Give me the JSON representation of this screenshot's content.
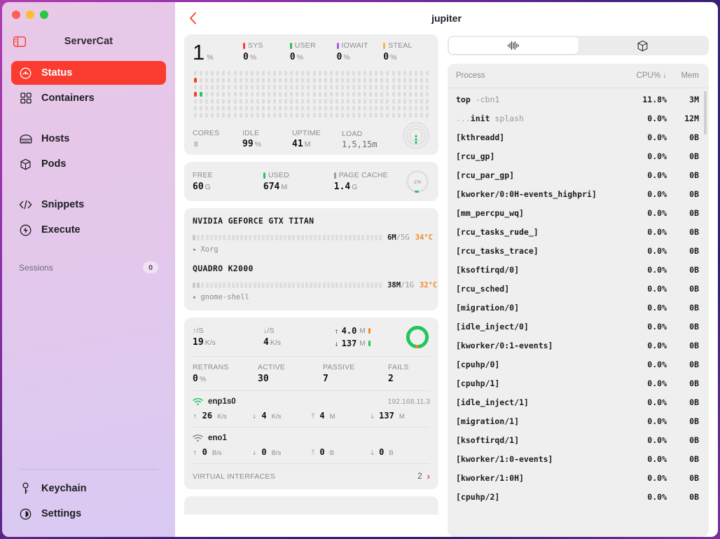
{
  "window": {
    "traffic_lights": [
      "close",
      "minimize",
      "zoom"
    ]
  },
  "sidebar": {
    "app_title": "ServerCat",
    "toggle_icon": "sidebar-toggle-icon",
    "items": [
      {
        "label": "Status",
        "icon": "status-gauge-icon",
        "active": true
      },
      {
        "label": "Containers",
        "icon": "grid-squares-icon",
        "active": false
      },
      {
        "label": "Hosts",
        "icon": "server-rack-icon",
        "active": false
      },
      {
        "label": "Pods",
        "icon": "cube-icon",
        "active": false
      },
      {
        "label": "Snippets",
        "icon": "code-brackets-icon",
        "active": false
      },
      {
        "label": "Execute",
        "icon": "bolt-circle-icon",
        "active": false
      }
    ],
    "sessions_label": "Sessions",
    "sessions_count": "0",
    "bottom_items": [
      {
        "label": "Keychain",
        "icon": "key-icon"
      },
      {
        "label": "Settings",
        "icon": "gear-icon"
      }
    ],
    "accent": "#fa3b30"
  },
  "topbar": {
    "back_icon": "chevron-left-icon",
    "host": "jupiter"
  },
  "cpu": {
    "value": "1",
    "unit": "%",
    "stats": [
      {
        "label": "SYS",
        "value": "0",
        "unit": "%",
        "color": "#fa3b30"
      },
      {
        "label": "USER",
        "value": "0",
        "unit": "%",
        "color": "#22c55e"
      },
      {
        "label": "IOWAIT",
        "value": "0",
        "unit": "%",
        "color": "#a855f7"
      },
      {
        "label": "STEAL",
        "value": "0",
        "unit": "%",
        "color": "#f5b battery"
      }
    ],
    "footer": [
      {
        "label": "CORES",
        "value": "8",
        "unit": ""
      },
      {
        "label": "IDLE",
        "value": "99",
        "unit": "%"
      },
      {
        "label": "UPTIME",
        "value": "41",
        "unit": "M"
      },
      {
        "label": "LOAD",
        "value": "1,5,15m",
        "unit": ""
      }
    ],
    "gauge_icon": "load-rings-gauge"
  },
  "memory": {
    "stats": [
      {
        "label": "FREE",
        "value": "60",
        "unit": "G",
        "color": null
      },
      {
        "label": "USED",
        "value": "674",
        "unit": "M",
        "color": "#22c55e"
      },
      {
        "label": "PAGE CACHE",
        "value": "1.4",
        "unit": "G",
        "color": "#9a9a9a"
      }
    ],
    "gauge_label": "1%"
  },
  "gpus": [
    {
      "name": "NVIDIA GEFORCE GTX TITAN",
      "mem_used": "6M",
      "mem_total": "5G",
      "temp": "34°C",
      "process": "Xorg",
      "bar_pct": 2
    },
    {
      "name": "QUADRO K2000",
      "mem_used": "38M",
      "mem_total": "1G",
      "temp": "32°C",
      "process": "gnome-shell",
      "bar_pct": 4
    }
  ],
  "network": {
    "up_label": "↑/S",
    "up_value": "19",
    "up_unit": "K/s",
    "down_label": "↓/S",
    "down_value": "4",
    "down_unit": "K/s",
    "total_up": "4.0",
    "total_up_unit": "M",
    "total_down": "137",
    "total_down_unit": "M",
    "mid": [
      {
        "label": "RETRANS",
        "value": "0",
        "unit": "%"
      },
      {
        "label": "ACTIVE",
        "value": "30",
        "unit": ""
      },
      {
        "label": "PASSIVE",
        "value": "7",
        "unit": ""
      },
      {
        "label": "FAILS",
        "value": "2",
        "unit": ""
      }
    ],
    "interfaces": [
      {
        "name": "enp1s0",
        "ip": "192.168.11.3",
        "icon": "wifi-icon",
        "online": true,
        "up_rate": "26",
        "up_rate_unit": "K/s",
        "down_rate": "4",
        "down_rate_unit": "K/s",
        "up_total": "4",
        "up_total_unit": "M",
        "down_total": "137",
        "down_total_unit": "M"
      },
      {
        "name": "eno1",
        "ip": "",
        "icon": "wifi-icon",
        "online": false,
        "up_rate": "0",
        "up_rate_unit": "B/s",
        "down_rate": "0",
        "down_rate_unit": "B/s",
        "up_total": "0",
        "up_total_unit": "B",
        "down_total": "0",
        "down_total_unit": "B"
      }
    ],
    "virtual_label": "VIRTUAL INTERFACES",
    "virtual_count": "2"
  },
  "tabs": [
    {
      "icon": "waveform-icon",
      "selected": true
    },
    {
      "icon": "cube-icon",
      "selected": false
    }
  ],
  "processes": {
    "columns": {
      "name": "Process",
      "cpu": "CPU% ↓",
      "mem": "Mem"
    },
    "rows": [
      {
        "name": "top",
        "arg": " -cbn1",
        "dim": "",
        "cpu": "11.8%",
        "mem": "3M"
      },
      {
        "name": "init",
        "arg": " splash",
        "dim": "...",
        "cpu": "0.0%",
        "mem": "12M"
      },
      {
        "name": "[kthreadd]",
        "arg": "",
        "dim": "",
        "cpu": "0.0%",
        "mem": "0B"
      },
      {
        "name": "[rcu_gp]",
        "arg": "",
        "dim": "",
        "cpu": "0.0%",
        "mem": "0B"
      },
      {
        "name": "[rcu_par_gp]",
        "arg": "",
        "dim": "",
        "cpu": "0.0%",
        "mem": "0B"
      },
      {
        "name": "[kworker/0:0H-events_highpri]",
        "arg": "",
        "dim": "",
        "cpu": "0.0%",
        "mem": "0B"
      },
      {
        "name": "[mm_percpu_wq]",
        "arg": "",
        "dim": "",
        "cpu": "0.0%",
        "mem": "0B"
      },
      {
        "name": "[rcu_tasks_rude_]",
        "arg": "",
        "dim": "",
        "cpu": "0.0%",
        "mem": "0B"
      },
      {
        "name": "[rcu_tasks_trace]",
        "arg": "",
        "dim": "",
        "cpu": "0.0%",
        "mem": "0B"
      },
      {
        "name": "[ksoftirqd/0]",
        "arg": "",
        "dim": "",
        "cpu": "0.0%",
        "mem": "0B"
      },
      {
        "name": "[rcu_sched]",
        "arg": "",
        "dim": "",
        "cpu": "0.0%",
        "mem": "0B"
      },
      {
        "name": "[migration/0]",
        "arg": "",
        "dim": "",
        "cpu": "0.0%",
        "mem": "0B"
      },
      {
        "name": "[idle_inject/0]",
        "arg": "",
        "dim": "",
        "cpu": "0.0%",
        "mem": "0B"
      },
      {
        "name": "[kworker/0:1-events]",
        "arg": "",
        "dim": "",
        "cpu": "0.0%",
        "mem": "0B"
      },
      {
        "name": "[cpuhp/0]",
        "arg": "",
        "dim": "",
        "cpu": "0.0%",
        "mem": "0B"
      },
      {
        "name": "[cpuhp/1]",
        "arg": "",
        "dim": "",
        "cpu": "0.0%",
        "mem": "0B"
      },
      {
        "name": "[idle_inject/1]",
        "arg": "",
        "dim": "",
        "cpu": "0.0%",
        "mem": "0B"
      },
      {
        "name": "[migration/1]",
        "arg": "",
        "dim": "",
        "cpu": "0.0%",
        "mem": "0B"
      },
      {
        "name": "[ksoftirqd/1]",
        "arg": "",
        "dim": "",
        "cpu": "0.0%",
        "mem": "0B"
      },
      {
        "name": "[kworker/1:0-events]",
        "arg": "",
        "dim": "",
        "cpu": "0.0%",
        "mem": "0B"
      },
      {
        "name": "[kworker/1:0H]",
        "arg": "",
        "dim": "",
        "cpu": "0.0%",
        "mem": "0B"
      },
      {
        "name": "[cpuhp/2]",
        "arg": "",
        "dim": "",
        "cpu": "0.0%",
        "mem": "0B"
      }
    ]
  },
  "cpu_matrix": {
    "cols": 42,
    "rows": 7,
    "marks": [
      {
        "col": 0,
        "row": 1,
        "color": "#fa3b30"
      },
      {
        "col": 0,
        "row": 3,
        "color": "#fa3b30"
      },
      {
        "col": 1,
        "row": 3,
        "color": "#22c55e"
      }
    ]
  }
}
